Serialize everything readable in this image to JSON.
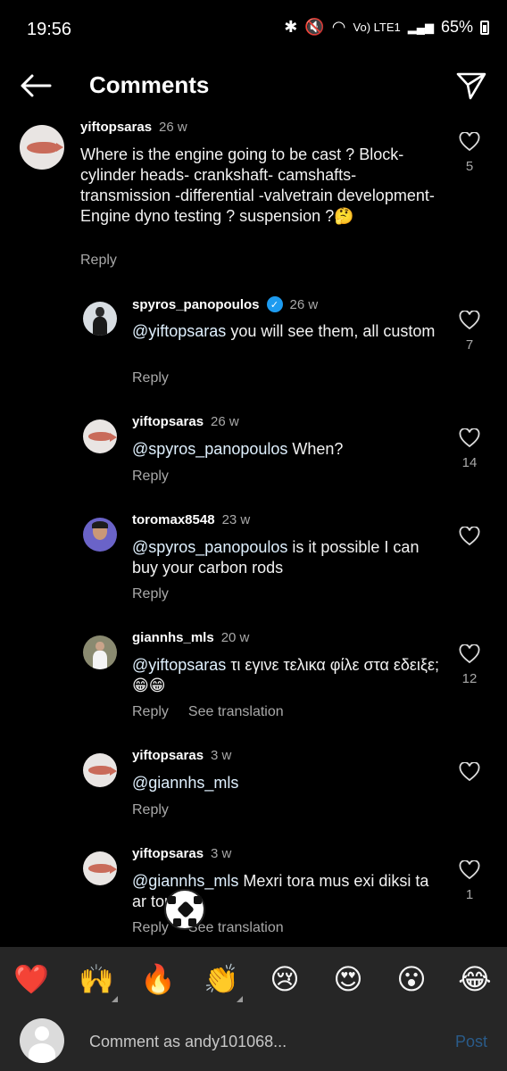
{
  "status_bar": {
    "time": "19:56",
    "battery": "65%",
    "network": "Vo) LTE1"
  },
  "header": {
    "title": "Comments"
  },
  "comments": [
    {
      "username": "yiftopsaras",
      "age": "26 w",
      "text": "Where is the engine going to be cast ? Block-cylinder heads- crankshaft- camshafts-transmission -differential -valvetrain development- Engine dyno testing ? suspension ?🤔",
      "reply_label": "Reply",
      "likes": "5"
    },
    {
      "username": "spyros_panopoulos",
      "verified": true,
      "age": "26 w",
      "mention": "@yiftopsaras",
      "text": " you will see them, all custom",
      "reply_label": "Reply",
      "likes": "7"
    },
    {
      "username": "yiftopsaras",
      "age": "26 w",
      "mention": "@spyros_panopoulos",
      "text": " When?",
      "reply_label": "Reply",
      "likes": "14"
    },
    {
      "username": "toromax8548",
      "age": "23 w",
      "mention": "@spyros_panopoulos",
      "text": " is it possible I can buy your carbon rods",
      "reply_label": "Reply",
      "likes": ""
    },
    {
      "username": "giannhs_mls",
      "age": "20 w",
      "mention": "@yiftopsaras",
      "text": " τι εγινε τελικα φίλε στα εδειξε; 😁😁",
      "reply_label": "Reply",
      "translation_label": "See translation",
      "likes": "12"
    },
    {
      "username": "yiftopsaras",
      "age": "3 w",
      "mention": "@giannhs_mls",
      "text": "",
      "reply_label": "Reply",
      "likes": ""
    },
    {
      "username": "yiftopsaras",
      "age": "3 w",
      "mention": "@giannhs_mls",
      "text": " Mexri tora mus exi diksi ta ar   tou.🤣",
      "reply_label": "Reply",
      "translation_label": "See translation",
      "likes": "1"
    }
  ],
  "emoji_bar": [
    "❤️",
    "🙌",
    "🔥",
    "👏",
    "😢",
    "😍",
    "😮",
    "😂"
  ],
  "composer": {
    "placeholder": "Comment as andy101068...",
    "post_label": "Post"
  },
  "colors": {
    "background": "#000000",
    "muted": "#a8a8a8",
    "verified": "#1d9bf0",
    "post_disabled": "#2a5b89"
  }
}
